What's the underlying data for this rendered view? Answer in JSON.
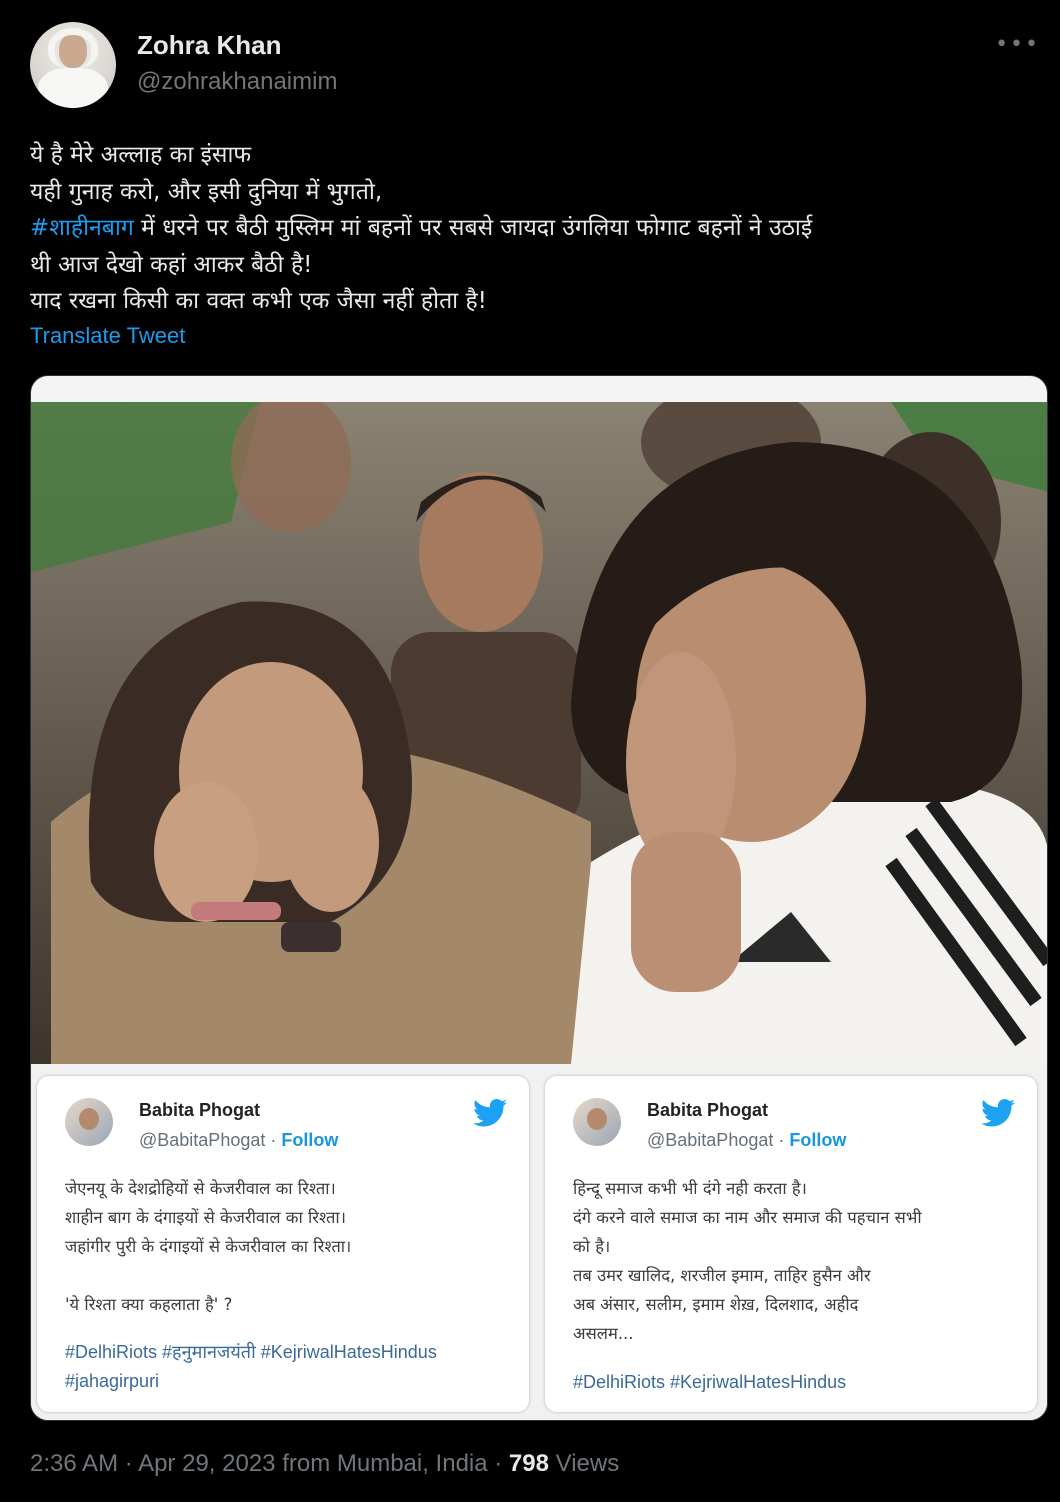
{
  "author": {
    "name": "Zohra Khan",
    "handle": "@zohrakhanaimim",
    "more_icon": "ellipsis-icon"
  },
  "tweet": {
    "line1": "ये है मेरे अल्लाह का इंसाफ",
    "line2": "यही गुनाह करो, और इसी दुनिया में भुगतो,",
    "line3_hashtag": "#शाहीनबाग",
    "line3_rest": " में धरने पर बैठी मुस्लिम मां बहनों  पर सबसे जायदा उंगलिया फोगाट बहनों ने उठाई",
    "line4": "थी आज देखो कहां आकर बैठी है!",
    "line5": "याद रखना किसी का वक्त कभी एक जैसा नहीं होता है!",
    "translate_label": "Translate Tweet"
  },
  "embedded_cards": [
    {
      "name": "Babita Phogat",
      "handle": "@BabitaPhogat",
      "sep": " · ",
      "follow": "Follow",
      "lines": [
        "जेएनयू के देशद्रोहियों से केजरीवाल का रिश्ता।",
        "शाहीन बाग के दंगाइयों से केजरीवाल का रिश्ता।",
        "जहांगीर पुरी के दंगाइयों से केजरीवाल का रिश्ता।",
        "",
        "'ये रिश्ता क्या कहलाता है' ?"
      ],
      "tags": [
        "#DelhiRiots #हनुमानजयंती #KejriwalHatesHindus",
        "#jahagirpuri"
      ]
    },
    {
      "name": "Babita Phogat",
      "handle": "@BabitaPhogat",
      "sep": " · ",
      "follow": "Follow",
      "lines": [
        "हिन्दू समाज कभी भी दंगे नही करता है।",
        "दंगे करने वाले समाज का नाम और समाज की पहचान सभी",
        "को है।",
        "तब उमर खालिद, शरजील इमाम, ताहिर हुसैन और",
        "अब अंसार, सलीम, इमाम शेख़, दिलशाद, अहीद",
        "असलम..."
      ],
      "tags": [
        "#DelhiRiots #KejriwalHatesHindus"
      ]
    }
  ],
  "meta": {
    "time": "2:36 AM",
    "date": "Apr 29, 2023",
    "source": "from Mumbai, India",
    "views_count": "798",
    "views_label": "Views"
  },
  "colors": {
    "background": "#000000",
    "text": "#e7e9ea",
    "muted": "#71767b",
    "link": "#1d9bf0"
  }
}
